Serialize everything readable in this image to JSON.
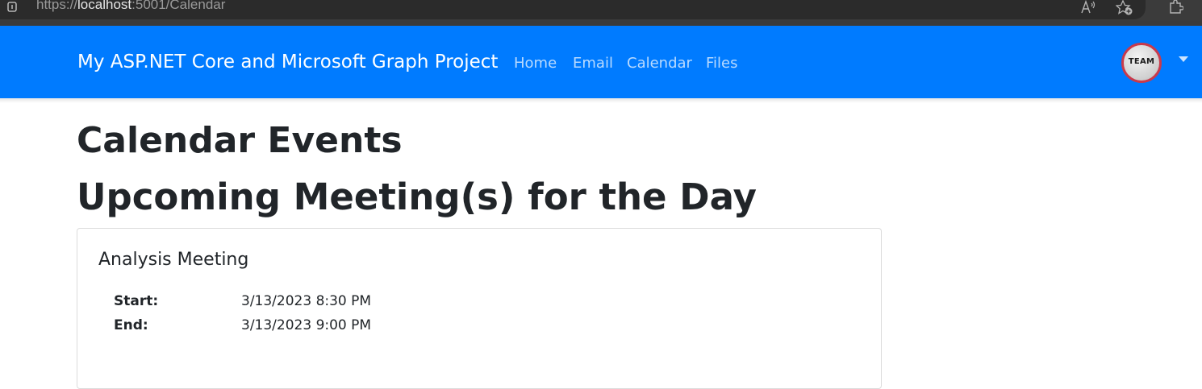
{
  "browser": {
    "url_scheme": "https://",
    "url_host": "localhost",
    "url_rest": ":5001/Calendar",
    "icons": [
      "site-info-icon",
      "read-aloud-icon",
      "add-favorite-icon",
      "extensions-icon"
    ]
  },
  "navbar": {
    "brand": "My ASP.NET Core and Microsoft Graph Project",
    "links": [
      {
        "label": "Home"
      },
      {
        "label": "Email"
      },
      {
        "label": "Calendar"
      },
      {
        "label": "Files"
      }
    ],
    "avatar_text": "TEAM",
    "accent_color": "#007bff"
  },
  "main": {
    "title": "Calendar Events",
    "subtitle": "Upcoming Meeting(s) for the Day",
    "events": [
      {
        "subject": "Analysis Meeting",
        "start_label": "Start:",
        "start_value": "3/13/2023 8:30 PM",
        "end_label": "End:",
        "end_value": "3/13/2023 9:00 PM"
      }
    ]
  }
}
